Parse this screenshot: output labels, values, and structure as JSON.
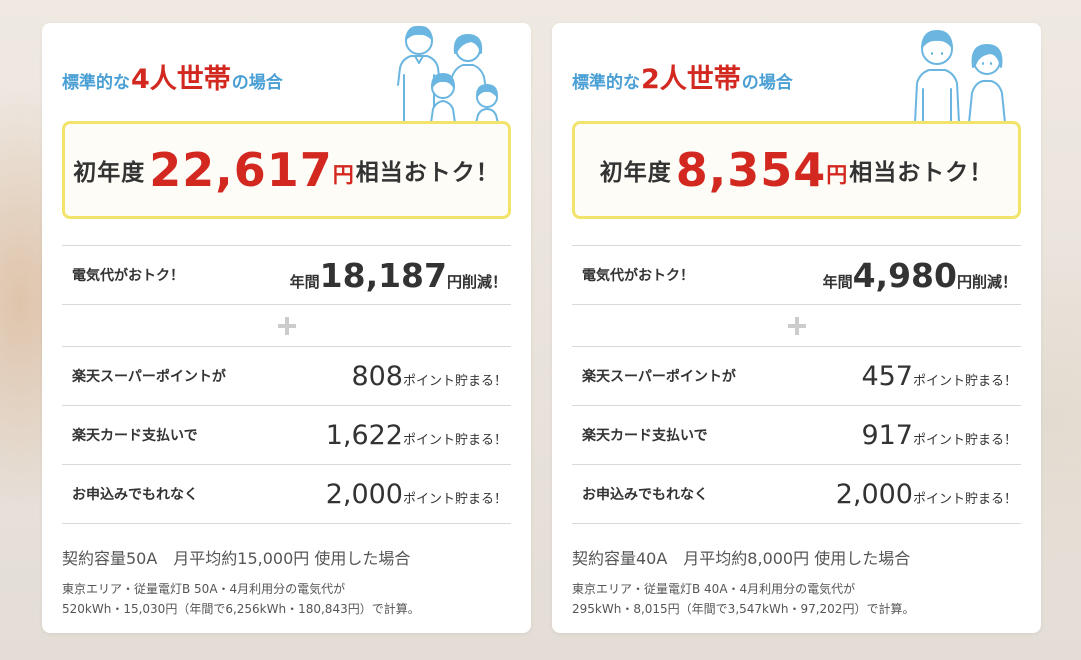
{
  "cards": [
    {
      "heading": {
        "pre": "標準的な",
        "big": "4人世帯",
        "post": "の場合"
      },
      "illustration_icon": "family-of-four-icon",
      "banner": {
        "pre": "初年度",
        "amount": "22,617",
        "unit": "円",
        "post": "相当おトク！"
      },
      "electricity": {
        "label": "電気代がおトク！",
        "prefix": "年間",
        "amount": "18,187",
        "suffix": "円削減！"
      },
      "plus_icon": "plus-icon",
      "points": [
        {
          "label": "楽天スーパーポイントが",
          "amount": "808",
          "suffix": "ポイント貯まる！"
        },
        {
          "label": "楽天カード支払いで",
          "amount": "1,622",
          "suffix": "ポイント貯まる！"
        },
        {
          "label": "お申込みでもれなく",
          "amount": "2,000",
          "suffix": "ポイント貯まる！"
        }
      ],
      "conditions": "契約容量50A　月平均約15,000円 使用した場合",
      "note_line1": "東京エリア・従量電灯B 50A・4月利用分の電気代が",
      "note_line2": "520kWh・15,030円（年間で6,256kWh・180,843円）で計算。"
    },
    {
      "heading": {
        "pre": "標準的な",
        "big": "2人世帯",
        "post": "の場合"
      },
      "illustration_icon": "couple-icon",
      "banner": {
        "pre": "初年度",
        "amount": "8,354",
        "unit": "円",
        "post": "相当おトク！"
      },
      "electricity": {
        "label": "電気代がおトク！",
        "prefix": "年間",
        "amount": "4,980",
        "suffix": "円削減！"
      },
      "plus_icon": "plus-icon",
      "points": [
        {
          "label": "楽天スーパーポイントが",
          "amount": "457",
          "suffix": "ポイント貯まる！"
        },
        {
          "label": "楽天カード支払いで",
          "amount": "917",
          "suffix": "ポイント貯まる！"
        },
        {
          "label": "お申込みでもれなく",
          "amount": "2,000",
          "suffix": "ポイント貯まる！"
        }
      ],
      "conditions": "契約容量40A　月平均約8,000円 使用した場合",
      "note_line1": "東京エリア・従量電灯B 40A・4月利用分の電気代が",
      "note_line2": "295kWh・8,015円（年間で3,547kWh・97,202円）で計算。"
    }
  ],
  "colors": {
    "heading_blue": "#4a9fd4",
    "accent_red": "#d2281f",
    "banner_border": "#f2e46a",
    "illustration_blue": "#6bb6e0",
    "text": "#333333"
  }
}
